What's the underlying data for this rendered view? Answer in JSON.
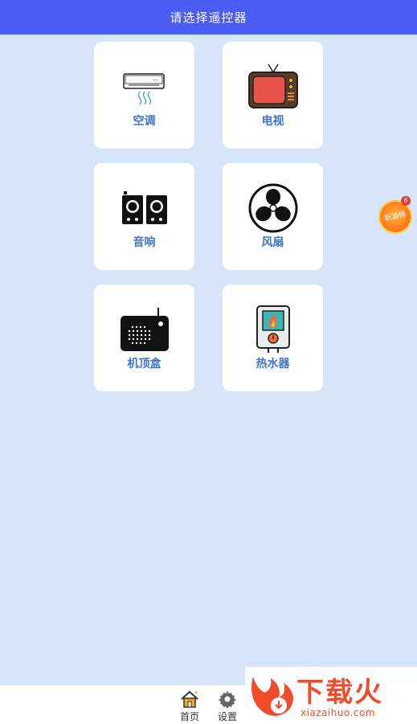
{
  "header": {
    "title": "请选择遥控器"
  },
  "devices": [
    {
      "label": "空调",
      "icon": "air-conditioner-icon"
    },
    {
      "label": "电视",
      "icon": "tv-icon"
    },
    {
      "label": "音响",
      "icon": "speaker-icon"
    },
    {
      "label": "风扇",
      "icon": "fan-icon"
    },
    {
      "label": "机顶盒",
      "icon": "set-top-box-icon"
    },
    {
      "label": "热水器",
      "icon": "water-heater-icon"
    }
  ],
  "floating_badge": {
    "text": "新游榜",
    "count": "8"
  },
  "bottom_nav": [
    {
      "label": "首页",
      "icon": "home-icon"
    },
    {
      "label": "设置",
      "icon": "gear-icon"
    }
  ],
  "watermark": {
    "title": "下载火",
    "site": "xiazaihuo.com"
  }
}
